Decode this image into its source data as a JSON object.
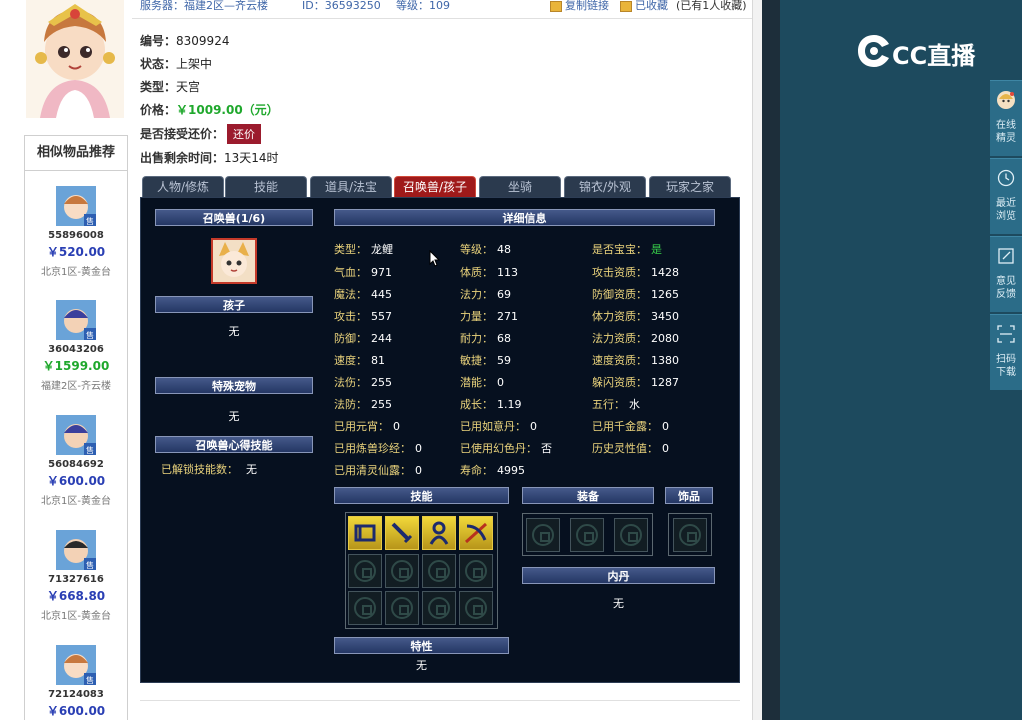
{
  "header": {
    "server": "服务器：福建2区—齐云楼",
    "id_text": "ID：36593250",
    "level_text": "等级：109",
    "copy_link": "复制链接",
    "favorited": "已收藏",
    "fav_count": "(已有1人收藏)"
  },
  "item": {
    "number_label": "编号：",
    "number": "8309924",
    "status_label": "状态：",
    "status": "上架中",
    "type_label": "类型：",
    "type": "天宫",
    "price_label": "价格：",
    "price": "￥1009.00（元）",
    "bargain_label": "是否接受还价：",
    "bargain_button": "还价",
    "remaining_label": "出售剩余时间：",
    "remaining": "13天14时"
  },
  "similar": {
    "title": "相似物品推荐",
    "items": [
      {
        "id": "55896008",
        "price": "￥520.00",
        "server": "北京1区-黄金台",
        "price_color": "#2a3fb4"
      },
      {
        "id": "36043206",
        "price": "￥1599.00",
        "server": "福建2区-齐云楼",
        "price_color": "#1fa82c"
      },
      {
        "id": "56084692",
        "price": "￥600.00",
        "server": "北京1区-黄金台",
        "price_color": "#2a3fb4"
      },
      {
        "id": "71327616",
        "price": "￥668.80",
        "server": "北京1区-黄金台",
        "price_color": "#2a3fb4"
      },
      {
        "id": "72124083",
        "price": "￥600.00",
        "server": "",
        "price_color": "#2a3fb4"
      }
    ]
  },
  "tabs": [
    "人物/修炼",
    "技能",
    "道具/法宝",
    "召唤兽/孩子",
    "坐骑",
    "锦衣/外观",
    "玩家之家"
  ],
  "active_tab": 3,
  "pet": {
    "summon_header": "召唤兽(1/6)",
    "child_header": "孩子",
    "child_value": "无",
    "special_header": "特殊宠物",
    "special_value": "无",
    "insight_header": "召唤兽心得技能",
    "unlocked_label": "已解锁技能数：",
    "unlocked_value": "无",
    "detail_header": "详细信息",
    "attrs": [
      [
        {
          "k": "类型：",
          "v": "龙鲤"
        },
        {
          "k": "等级：",
          "v": "48"
        },
        {
          "k": "是否宝宝：",
          "v": "是",
          "green": true
        }
      ],
      [
        {
          "k": "气血：",
          "v": "971"
        },
        {
          "k": "体质：",
          "v": "113"
        },
        {
          "k": "攻击资质：",
          "v": "1428"
        }
      ],
      [
        {
          "k": "魔法：",
          "v": "445"
        },
        {
          "k": "法力：",
          "v": "69"
        },
        {
          "k": "防御资质：",
          "v": "1265"
        }
      ],
      [
        {
          "k": "攻击：",
          "v": "557"
        },
        {
          "k": "力量：",
          "v": "271"
        },
        {
          "k": "体力资质：",
          "v": "3450"
        }
      ],
      [
        {
          "k": "防御：",
          "v": "244"
        },
        {
          "k": "耐力：",
          "v": "68"
        },
        {
          "k": "法力资质：",
          "v": "2080"
        }
      ],
      [
        {
          "k": "速度：",
          "v": "81"
        },
        {
          "k": "敏捷：",
          "v": "59"
        },
        {
          "k": "速度资质：",
          "v": "1380"
        }
      ],
      [
        {
          "k": "法伤：",
          "v": "255"
        },
        {
          "k": "潜能：",
          "v": "0"
        },
        {
          "k": "躲闪资质：",
          "v": "1287"
        }
      ],
      [
        {
          "k": "法防：",
          "v": "255"
        },
        {
          "k": "成长：",
          "v": "1.19"
        },
        {
          "k": "五行：",
          "v": "水"
        }
      ],
      [
        {
          "k": "已用元宵：",
          "v": "0"
        },
        {
          "k": "已用如意丹：",
          "v": "0"
        },
        {
          "k": "已用千金露：",
          "v": "0"
        }
      ],
      [
        {
          "k": "已用炼兽珍经：",
          "v": "0"
        },
        {
          "k": "已使用幻色丹：",
          "v": "否"
        },
        {
          "k": "历史灵性值：",
          "v": "0"
        }
      ],
      [
        {
          "k": "已用清灵仙露：",
          "v": "0"
        },
        {
          "k": "寿命：",
          "v": "4995"
        },
        {
          "k": "",
          "v": ""
        }
      ]
    ],
    "skills_header": "技能",
    "skill_icons": [
      "bow-skill-icon",
      "sword-skill-icon",
      "figure-skill-icon",
      "crossbow-skill-icon"
    ],
    "equip_header": "装备",
    "ornament_header": "饰品",
    "inner_dan_header": "内丹",
    "inner_dan_value": "无",
    "trait_header": "特性",
    "trait_value": "无"
  },
  "side": {
    "brand": "CC直播",
    "buttons": [
      {
        "label": "在线\n精灵",
        "icon": "avatar-icon"
      },
      {
        "label": "最近\n浏览",
        "icon": "clock-icon"
      },
      {
        "label": "意见\n反馈",
        "icon": "edit-icon"
      },
      {
        "label": "扫码\n下载",
        "icon": "qr-scan-icon"
      }
    ]
  }
}
